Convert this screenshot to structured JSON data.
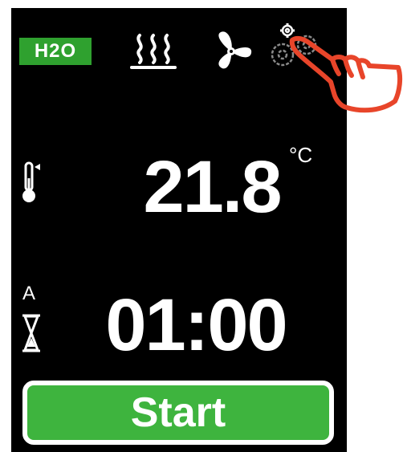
{
  "header": {
    "h2o_label": "H2O",
    "icons": [
      "steam-heat-icon",
      "fan-icon",
      "gear-icon"
    ]
  },
  "temperature": {
    "value": "21.8",
    "unit": "°C"
  },
  "timer": {
    "mode": "A",
    "value": "01:00"
  },
  "start": {
    "label": "Start"
  },
  "colors": {
    "screen_bg": "#000000",
    "accent_green": "#3eb43e",
    "badge_green": "#2fa12f",
    "pointer_red": "#e8452a"
  }
}
